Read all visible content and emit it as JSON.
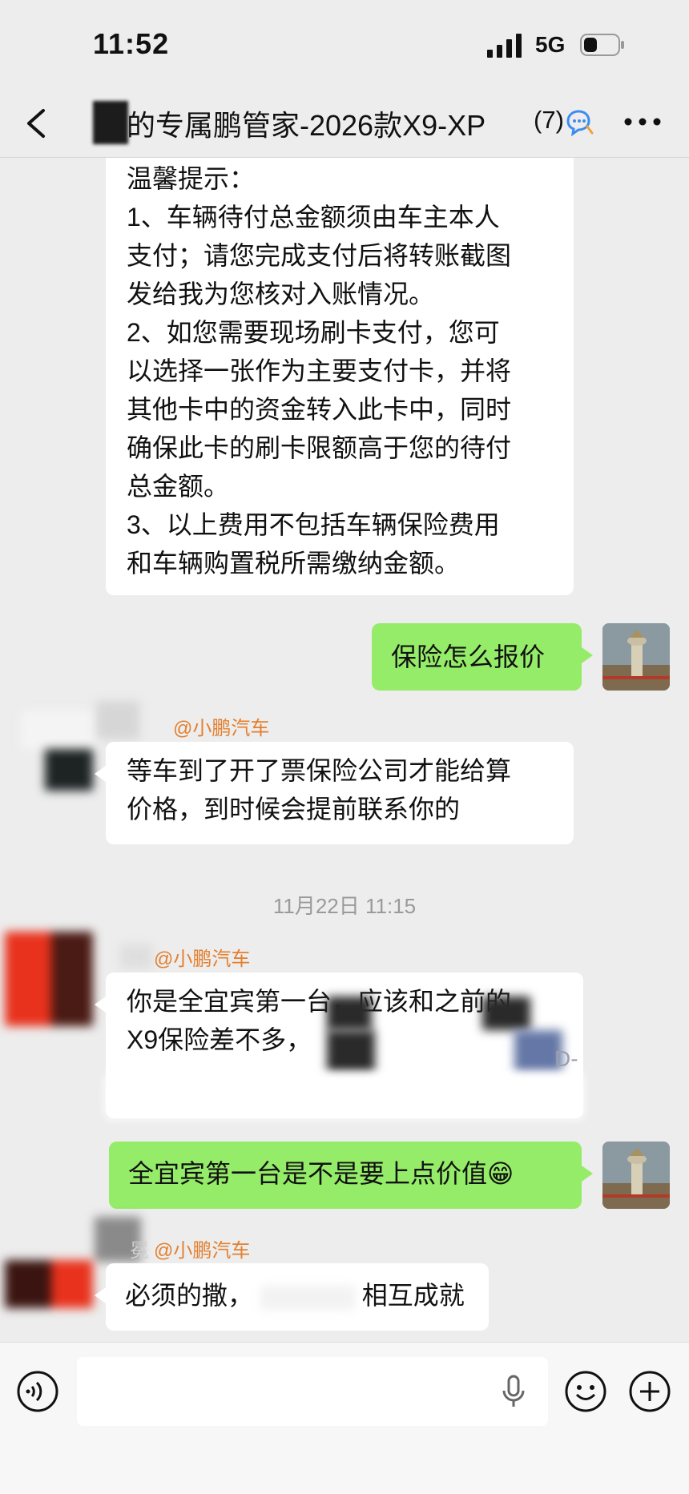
{
  "status": {
    "time": "11:52",
    "network": "5G"
  },
  "header": {
    "title": "的专属鹏管家-2026款X9-XP",
    "member_count": "(7)"
  },
  "messages": {
    "notice": {
      "lines": [
        "温馨提示：",
        "1、车辆待付总金额须由车主本人",
        "支付；请您完成支付后将转账截图",
        "发给我为您核对入账情况。",
        "2、如您需要现场刷卡支付，您可",
        "以选择一张作为主要支付卡，并将",
        "其他卡中的资金转入此卡中，同时",
        "确保此卡的刷卡限额高于您的待付",
        "总金额。",
        "3、以上费用不包括车辆保险费用",
        "和车辆购置税所需缴纳金额。"
      ]
    },
    "m1": {
      "text": "保险怎么报价"
    },
    "m2": {
      "sender": "@小鹏汽车",
      "lines": [
        "等车到了开了票保险公司才能给算",
        "价格，到时候会提前联系你的"
      ]
    },
    "timestamp": "11月22日 11:15",
    "m3": {
      "sender": "@小鹏汽车",
      "lines": [
        "你是全宜宾第一台，应该和之前的",
        "X9保险差不多，"
      ],
      "tail": "D-"
    },
    "m4": {
      "text": "全宜宾第一台是不是要上点价值😁"
    },
    "m5": {
      "sender_prefix": "冕",
      "sender": "@小鹏汽车",
      "part1": "必须的撒，",
      "part2": "相互成就"
    }
  },
  "colors": {
    "self_bubble": "#95ec69",
    "other_bubble": "#ffffff",
    "sender_name": "#e37f2f",
    "background": "#ededed"
  },
  "icons": [
    "back-arrow-icon",
    "group-chat-icon",
    "more-icon",
    "voice-icon",
    "microphone-icon",
    "emoji-icon",
    "plus-icon"
  ]
}
